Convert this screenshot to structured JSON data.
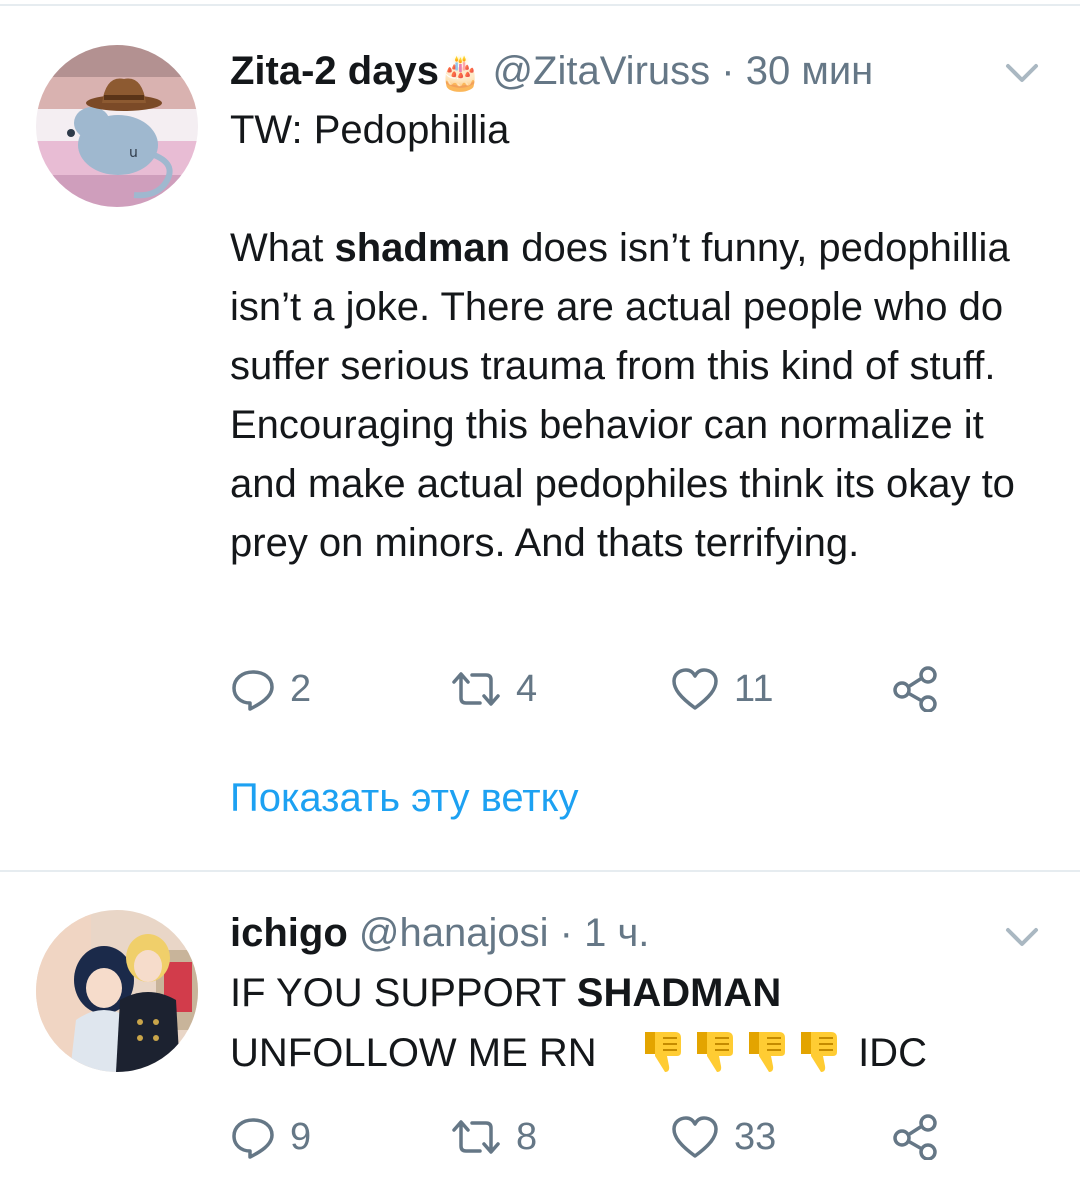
{
  "tweets": [
    {
      "name": "Zita-2 days",
      "name_emoji": "🎂",
      "handle": "@ZitaViruss",
      "separator": "·",
      "time": "30 мин",
      "line1": "TW: Pedophillia",
      "p_pre": "What ",
      "p_bold": "shadman",
      "p_post": " does isn’t funny, pedophillia isn’t a joke. There are actual people who do suffer serious trauma from this kind of stuff. Encouraging this behavior can normalize it and make actual pedophiles think its okay to prey on minors. And thats terrifying.",
      "replies": "2",
      "retweets": "4",
      "likes": "11",
      "show_thread": "Показать эту ветку"
    },
    {
      "name": "ichigo",
      "handle": "@hanajosi",
      "separator": "·",
      "time": "1 ч.",
      "line1_pre": "IF YOU SUPPORT ",
      "line1_bold": "SHADMAN",
      "line2_pre": "UNFOLLOW ME RN",
      "line2_post": "IDC",
      "thumb_emoji": "👎",
      "replies": "9",
      "retweets": "8",
      "likes": "33"
    }
  ],
  "colors": {
    "accent": "#1da1f2",
    "secondary": "#657786",
    "divider": "#e6ecf0"
  },
  "icons": [
    "reply-icon",
    "retweet-icon",
    "like-icon",
    "share-icon",
    "chevron-down-icon",
    "thumbs-down-icon"
  ]
}
